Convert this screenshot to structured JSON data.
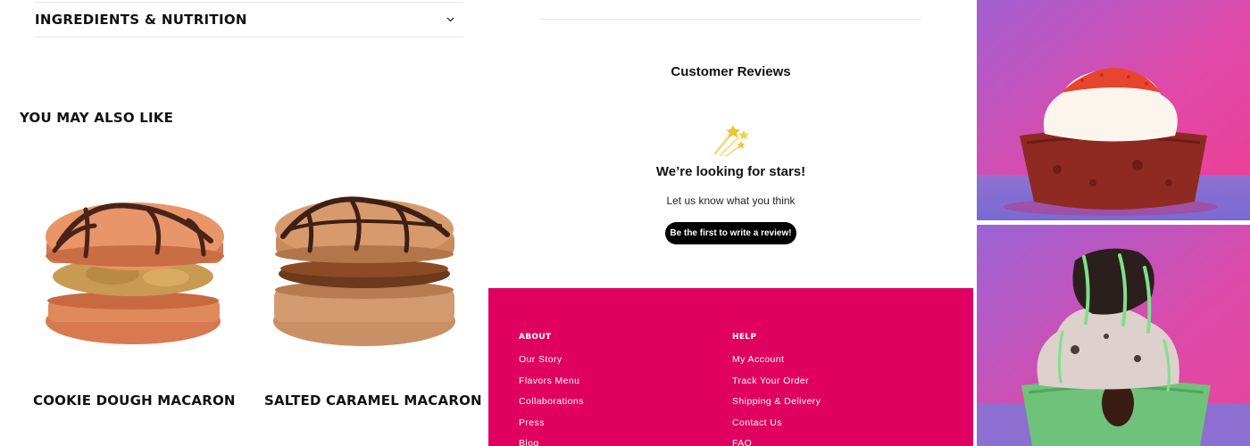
{
  "accordion": {
    "title": "INGREDIENTS & NUTRITION"
  },
  "related": {
    "heading": "YOU MAY ALSO LIKE",
    "products": [
      {
        "name": "COOKIE DOUGH MACARON",
        "icon": "cookie-dough-macaron-image"
      },
      {
        "name": "SALTED CARAMEL MACARON",
        "icon": "salted-caramel-macaron-image"
      }
    ]
  },
  "reviews": {
    "title": "Customer Reviews",
    "empty_title": "We’re looking for stars!",
    "empty_subtitle": "Let us know what you think",
    "button_label": "Be the first to write a review!",
    "icon": "shooting-stars-icon"
  },
  "footer": {
    "background": "#e0005f",
    "about": {
      "heading": "ABOUT",
      "links": [
        "Our Story",
        "Flavors Menu",
        "Collaborations",
        "Press",
        "Blog"
      ]
    },
    "help": {
      "heading": "HELP",
      "links": [
        "My Account",
        "Track Your Order",
        "Shipping & Delivery",
        "Contact Us",
        "FAQ"
      ]
    }
  },
  "photos": [
    "red-velvet-cupcake-photo",
    "mint-chocolate-cupcake-photo"
  ]
}
